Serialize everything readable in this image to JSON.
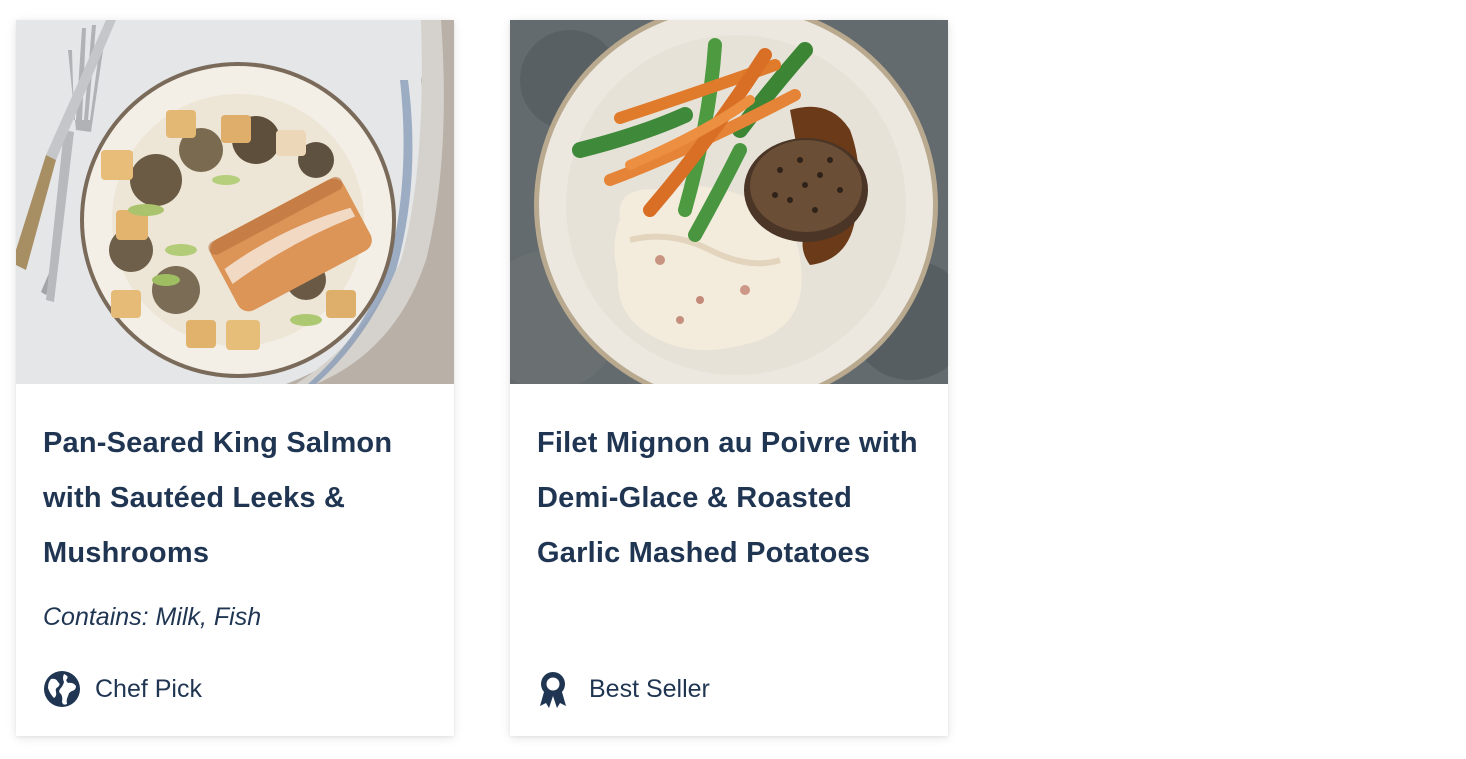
{
  "cards": [
    {
      "title": "Pan-Seared King Salmon with Sautéed Leeks & Mushrooms",
      "allergens": "Contains: Milk, Fish",
      "badge": {
        "label": "Chef Pick",
        "icon": "globe-icon"
      },
      "photo": "salmon-dish-photo"
    },
    {
      "title": "Filet Mignon au Poivre with Demi-Glace & Roasted Garlic Mashed Potatoes",
      "badge": {
        "label": "Best Seller",
        "icon": "award-ribbon-icon"
      },
      "photo": "filet-mignon-dish-photo"
    }
  ],
  "colors": {
    "text": "#1f3552",
    "card_bg": "#ffffff"
  }
}
